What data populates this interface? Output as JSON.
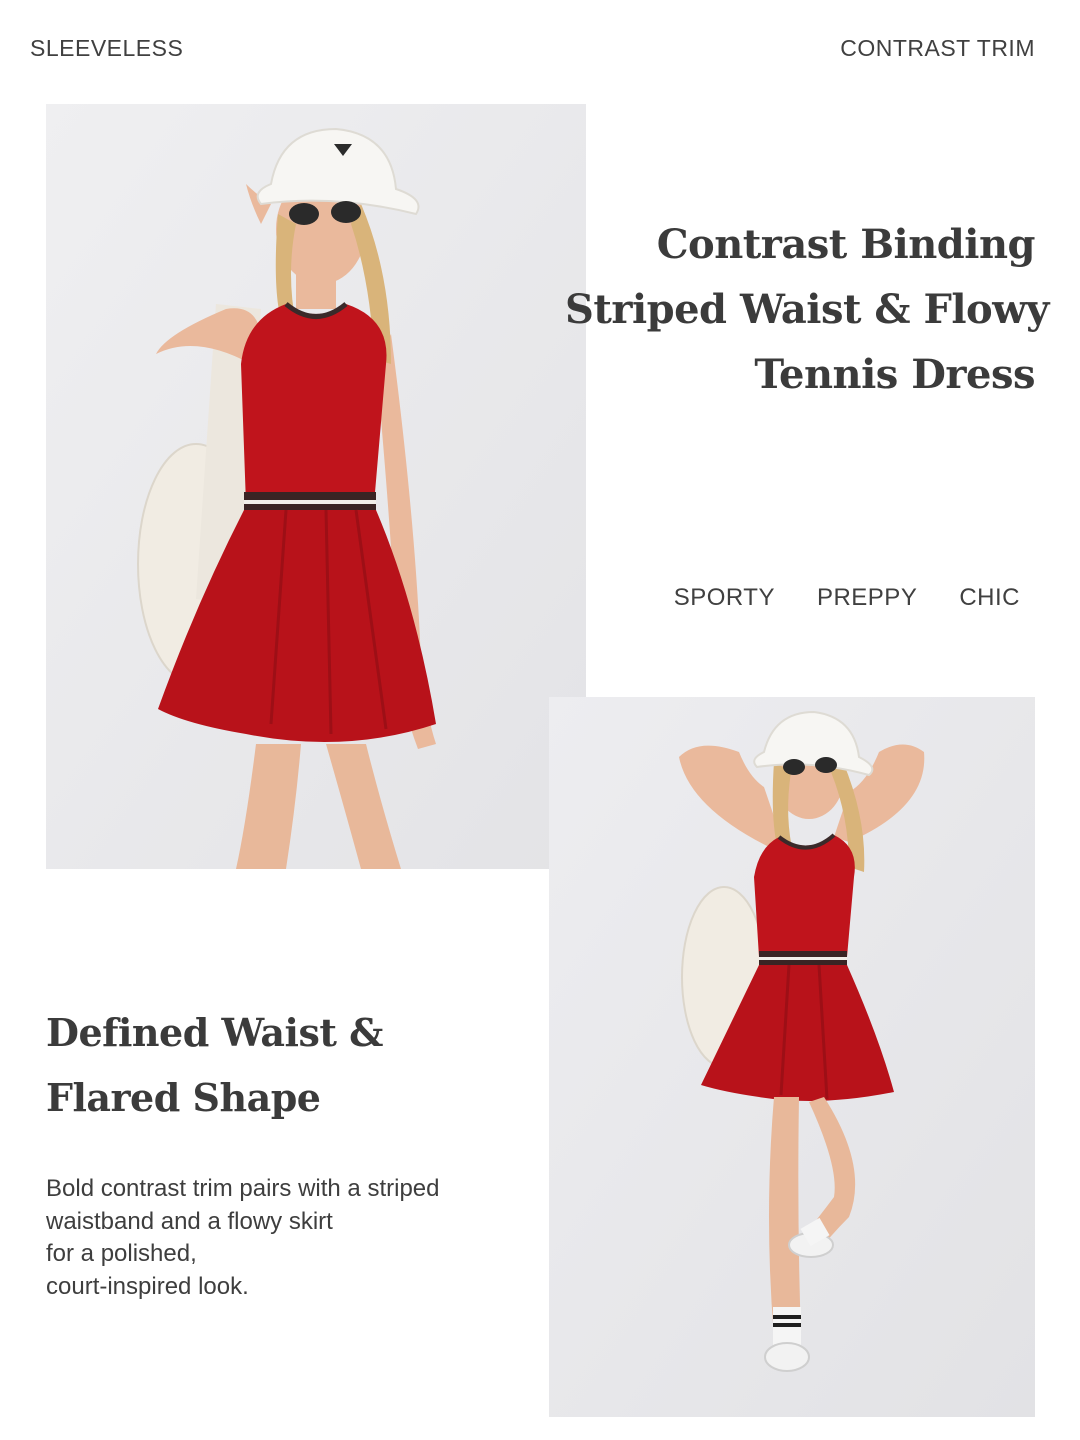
{
  "tags": {
    "left": "SLEEVELESS",
    "right": "CONTRAST TRIM"
  },
  "headline_main": {
    "line1": "Contrast Binding",
    "line2": "Striped Waist & Flowy",
    "line3": "Tennis Dress"
  },
  "styles": [
    "SPORTY",
    "PREPPY",
    "CHIC"
  ],
  "headline_secondary": {
    "line1": "Defined Waist &",
    "line2": "Flared Shape"
  },
  "body_copy": {
    "line1": "Bold contrast trim pairs with a striped",
    "line2": "waistband and a flowy skirt",
    "line3": "for a polished,",
    "line4": "court-inspired look."
  },
  "colors": {
    "dress_red": "#c0141c",
    "photo_bg": "#ebebed",
    "text": "#3e3e3e"
  }
}
